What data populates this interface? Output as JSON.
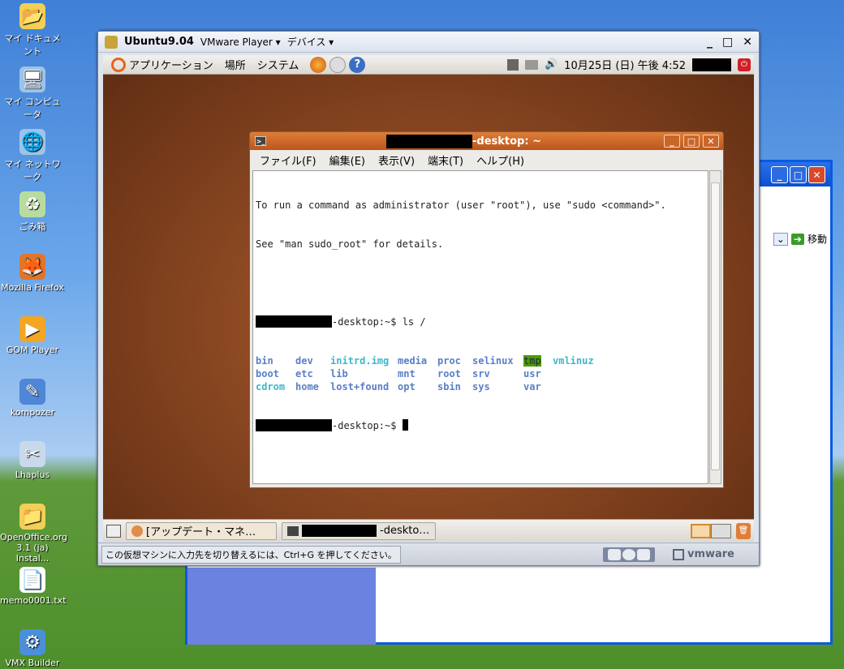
{
  "desktop": {
    "icons": [
      {
        "label": "マイ ドキュメント",
        "icon": "folder-documents-icon",
        "color": "#f2cf55",
        "glyph": "📂"
      },
      {
        "label": "マイ コンピュータ",
        "icon": "computer-icon",
        "color": "#9fc3e8",
        "glyph": "🖥"
      },
      {
        "label": "マイ ネットワーク",
        "icon": "network-icon",
        "color": "#9fc3e8",
        "glyph": "🌐"
      },
      {
        "label": "ごみ箱",
        "icon": "recycle-bin-icon",
        "color": "#b8dca0",
        "glyph": "♻"
      },
      {
        "label": "Mozilla Firefox",
        "icon": "firefox-icon",
        "color": "#e2752a",
        "glyph": "🦊"
      },
      {
        "label": "GOM Player",
        "icon": "gom-player-icon",
        "color": "#f3a623",
        "glyph": "▶"
      },
      {
        "label": "kompozer",
        "icon": "kompozer-icon",
        "color": "#4f86d6",
        "glyph": "✎"
      },
      {
        "label": "Lhaplus",
        "icon": "lhaplus-icon",
        "color": "#c9d9ec",
        "glyph": "✂"
      },
      {
        "label": "OpenOffice.org 3.1 (ja) Instal...",
        "icon": "folder-icon",
        "color": "#f2cf55",
        "glyph": "📁"
      },
      {
        "label": "memo0001.txt",
        "icon": "text-file-icon",
        "color": "#ffffff",
        "glyph": "📄"
      },
      {
        "label": "VMX Builder",
        "icon": "vmx-builder-icon",
        "color": "#4a8fd8",
        "glyph": "⚙"
      }
    ]
  },
  "background_window": {
    "go_label": "移動"
  },
  "vmware": {
    "title": "Ubuntu9.04",
    "menu_player": "VMware Player ▾",
    "menu_devices": "デバイス ▾",
    "status_message": "この仮想マシンに入力先を切り替えるには、Ctrl+G を押してください。",
    "brand": "vmware"
  },
  "gnome_top": {
    "applications": "アプリケーション",
    "places": "場所",
    "system": "システム",
    "clock": "10月25日 (日) 午後 4:52"
  },
  "terminal": {
    "title_suffix": "-desktop: ~",
    "menu": [
      "ファイル(F)",
      "編集(E)",
      "表示(V)",
      "端末(T)",
      "ヘルプ(H)"
    ],
    "intro1": "To run a command as administrator (user \"root\"), use \"sudo <command>\".",
    "intro2": "See \"man sudo_root\" for details.",
    "prompt_suffix": "-desktop:~$ ",
    "command": "ls /",
    "ls_rows": [
      [
        "bin",
        "dev",
        "initrd.img",
        "media",
        "proc",
        "selinux",
        "tmp",
        "vmlinuz"
      ],
      [
        "boot",
        "etc",
        "lib",
        "mnt",
        "root",
        "srv",
        "usr",
        ""
      ],
      [
        "cdrom",
        "home",
        "lost+found",
        "opt",
        "sbin",
        "sys",
        "var",
        ""
      ]
    ]
  },
  "gnome_bottom": {
    "task1": "[アップデート・マネ…",
    "task2_suffix": "-deskto…"
  }
}
